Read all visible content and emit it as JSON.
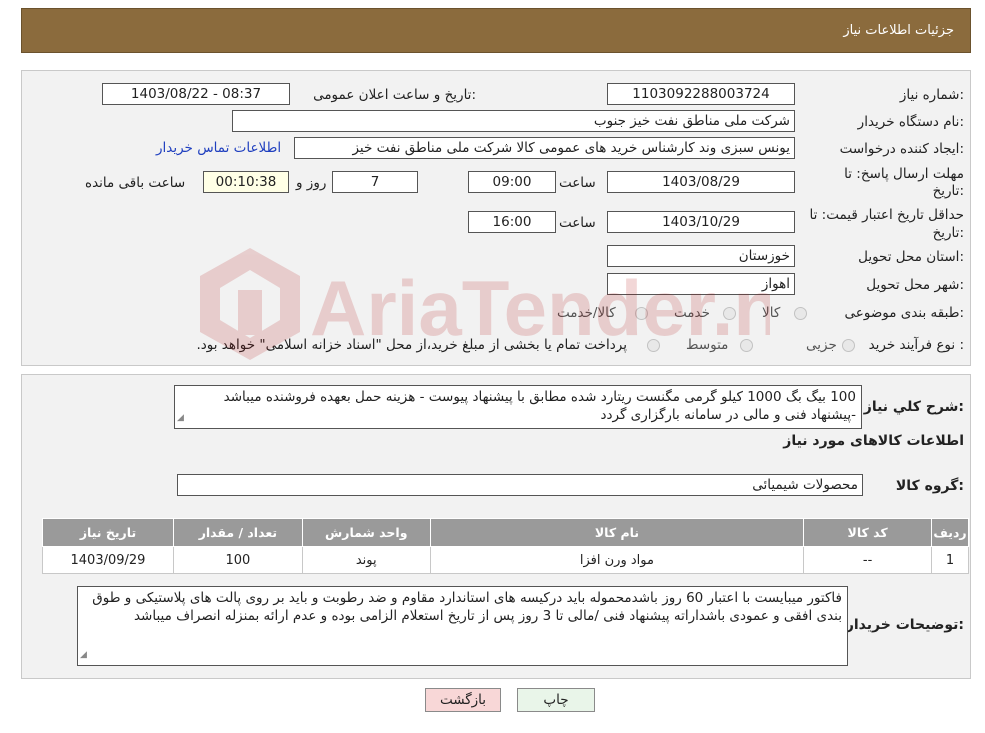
{
  "header": {
    "title": "جزئیات اطلاعات نیاز"
  },
  "details": {
    "need_number_label": "شماره نیاز:",
    "need_number": "1103092288003724",
    "announce_label": "تاریخ و ساعت اعلان عمومی:",
    "announce_value": "1403/08/22 - 08:37",
    "buyer_org_label": "نام دستگاه خریدار:",
    "buyer_org": "شرکت ملی مناطق نفت خیز جنوب",
    "creator_label": "ایجاد کننده درخواست:",
    "creator": "یونس سبزی وند کارشناس خرید های عمومی کالا شرکت ملی مناطق نفت خیز",
    "contact_link": "اطلاعات تماس خریدار",
    "reply_deadline_label_1": "مهلت ارسال پاسخ: تا",
    "reply_deadline_label_2": "تاریخ:",
    "reply_date": "1403/08/29",
    "time_label": "ساعت",
    "reply_time": "09:00",
    "days_value": "7",
    "days_label": "روز و",
    "remaining_time": "00:10:38",
    "remaining_label": "ساعت باقی مانده",
    "validity_label_1": "حداقل تاریخ اعتبار قیمت: تا",
    "validity_label_2": "تاریخ:",
    "validity_date": "1403/10/29",
    "validity_time": "16:00",
    "province_label": "استان محل تحویل:",
    "province": "خوزستان",
    "city_label": "شهر محل تحویل:",
    "city": "اهواز",
    "category_label": "طبقه بندی موضوعی:",
    "category_options": [
      "کالا",
      "خدمت",
      "کالا/خدمت"
    ],
    "process_label": "نوع فرآیند خرید :",
    "process_options": [
      "جزیی",
      "متوسط"
    ],
    "payment_note": "پرداخت تمام یا بخشی از مبلغ خرید،از محل \"اسناد خزانه اسلامی\" خواهد بود."
  },
  "summary": {
    "label": "شرح کلي نياز:",
    "text": "100 بیگ بگ 1000 کیلو گرمی مگنست ریتارد شده مطابق با پیشنهاد پیوست - هزینه حمل بعهده فروشنده میباشد -پیشنهاد فنی و مالی در سامانه بارگزاری گردد",
    "goods_info_title": "اطلاعات کالاهای مورد نیاز",
    "group_label": "گروه کالا:",
    "group_value": "محصولات شیمیائی"
  },
  "table": {
    "headers": [
      "ردیف",
      "کد کالا",
      "نام کالا",
      "واحد شمارش",
      "تعداد / مقدار",
      "تاریخ نیاز"
    ],
    "rows": [
      [
        "1",
        "--",
        "مواد ورن افزا",
        "پوند",
        "100",
        "1403/09/29"
      ]
    ]
  },
  "buyer_notes": {
    "label": "توضیحات خریدار:",
    "text": "فاکتور میبایست با اعتبار 60 روز باشدمحموله باید درکیسه های استاندارد مقاوم و ضد رطوبت و باید بر روی پالت های پلاستیکی و طوق بندی افقی و عمودی باشداراته پیشنهاد فنی /مالی تا 3 روز پس از تاریخ استعلام الزامی بوده و عدم ارائه بمنزله انصراف میباشد"
  },
  "buttons": {
    "print": "چاپ",
    "back": "بازگشت"
  },
  "watermark": {
    "text": "AriaTender.neT"
  },
  "colors": {
    "header_bg": "#8b6b3d",
    "link": "#1f3fbf",
    "table_header": "#9a9a9a",
    "back_button": "#f8d7d7",
    "print_button": "#e9f5e9"
  }
}
